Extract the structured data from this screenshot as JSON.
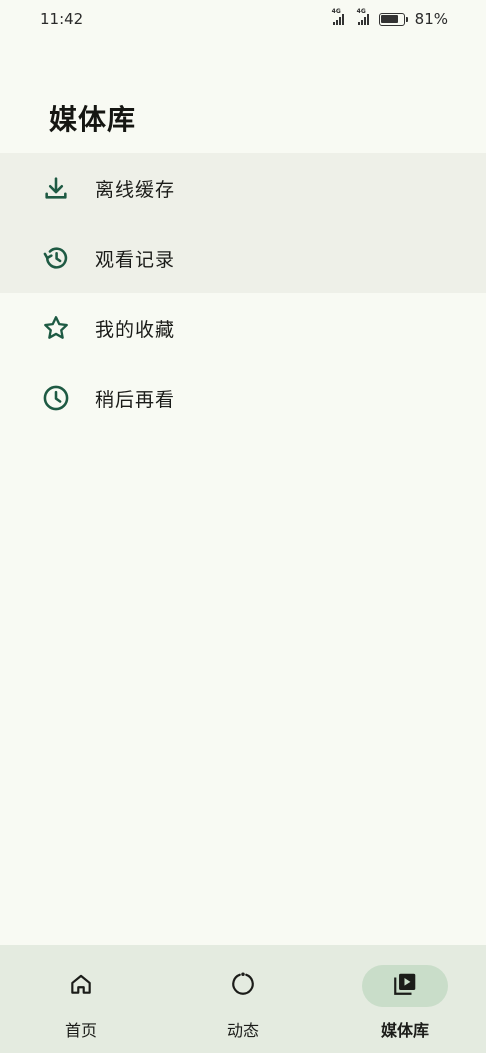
{
  "status_bar": {
    "time": "11:42",
    "network_1": "4G",
    "network_2": "4G",
    "battery_percent": "81%",
    "battery_level": 0.81
  },
  "page": {
    "title": "媒体库"
  },
  "menu": {
    "items": [
      {
        "label": "离线缓存",
        "icon": "download-icon"
      },
      {
        "label": "观看记录",
        "icon": "history-icon"
      },
      {
        "label": "我的收藏",
        "icon": "star-icon"
      },
      {
        "label": "稍后再看",
        "icon": "clock-icon"
      }
    ]
  },
  "bottom_nav": {
    "items": [
      {
        "label": "首页",
        "icon": "home-icon",
        "active": false
      },
      {
        "label": "动态",
        "icon": "refresh-icon",
        "active": false
      },
      {
        "label": "媒体库",
        "icon": "video-library-icon",
        "active": true
      }
    ]
  },
  "colors": {
    "background": "#f8faf3",
    "accent": "#1e5a43",
    "highlight_row": "#eef0e8",
    "nav_background": "#e4ebe0",
    "nav_active_pill": "#c9ddc9"
  }
}
